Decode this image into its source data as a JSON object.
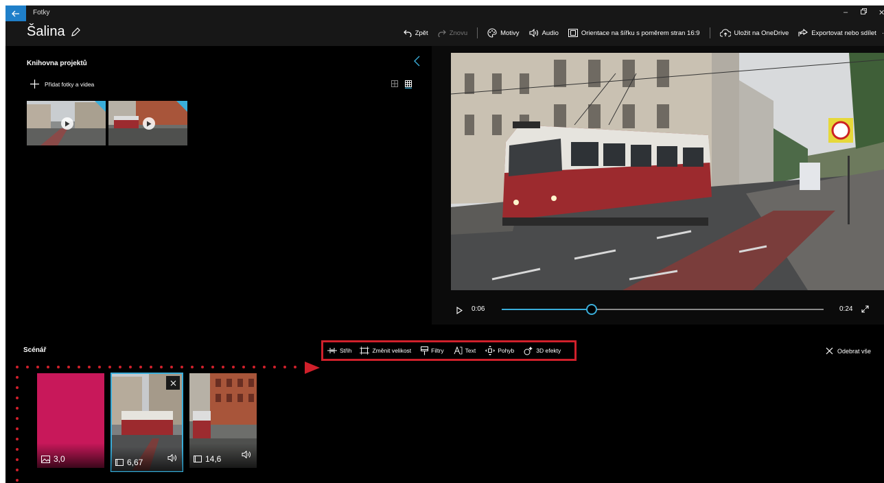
{
  "app": {
    "title": "Fotky",
    "back_icon": "back-arrow-icon",
    "accent_color": "#3aaeda",
    "highlight_color": "#d0202b"
  },
  "header": {
    "project_name": "Šalina",
    "commands": {
      "undo": "Zpět",
      "redo": "Znovu",
      "themes": "Motivy",
      "audio": "Audio",
      "orientation": "Orientace na šířku s poměrem stran 16:9",
      "onedrive": "Uložit na OneDrive",
      "export": "Exportovat nebo sdílet"
    }
  },
  "library": {
    "title": "Knihovna projektů",
    "add_label": "Přidat fotky a videa",
    "items": [
      {
        "type": "video"
      },
      {
        "type": "video"
      }
    ]
  },
  "player": {
    "current_time": "0:06",
    "total_time": "0:24",
    "progress": 0.28
  },
  "storyboard": {
    "title": "Scénář",
    "remove_all": "Odebrat vše",
    "tools": {
      "trim": "Střih",
      "resize": "Změnit velikost",
      "filters": "Filtry",
      "text": "Text",
      "motion": "Pohyb",
      "effects3d": "3D efekty"
    },
    "clips": [
      {
        "duration": "3,0",
        "kind": "title-card",
        "color": "#c8185a"
      },
      {
        "duration": "6,67",
        "kind": "video",
        "selected": true
      },
      {
        "duration": "14,6",
        "kind": "video"
      }
    ]
  }
}
